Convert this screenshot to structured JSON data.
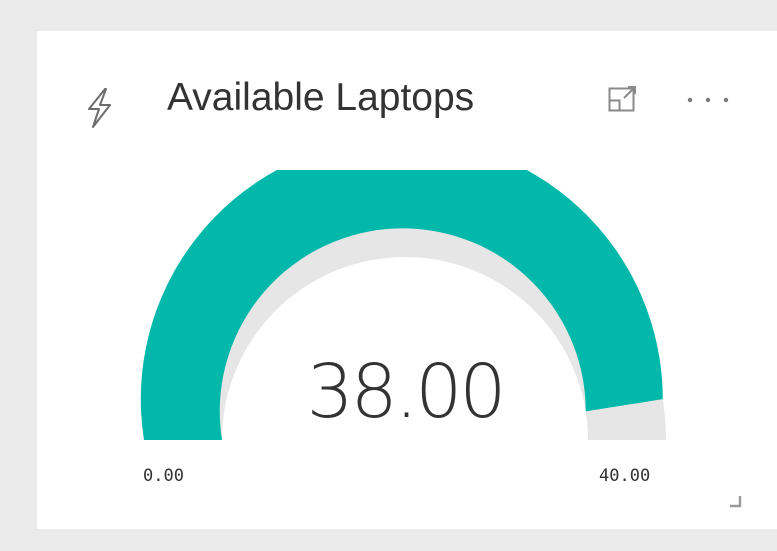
{
  "tile": {
    "title": "Available Laptops",
    "icons": {
      "header": "lightning-icon",
      "focus": "focus-mode-icon",
      "more": "more-options-icon",
      "resize": "resize-handle-icon"
    }
  },
  "gauge": {
    "value_label": "38.00",
    "min_label": "0.00",
    "max_label": "40.00",
    "value": 38,
    "min": 0,
    "max": 40,
    "fill_color": "#01b8aa",
    "track_color": "#e6e6e6"
  }
}
